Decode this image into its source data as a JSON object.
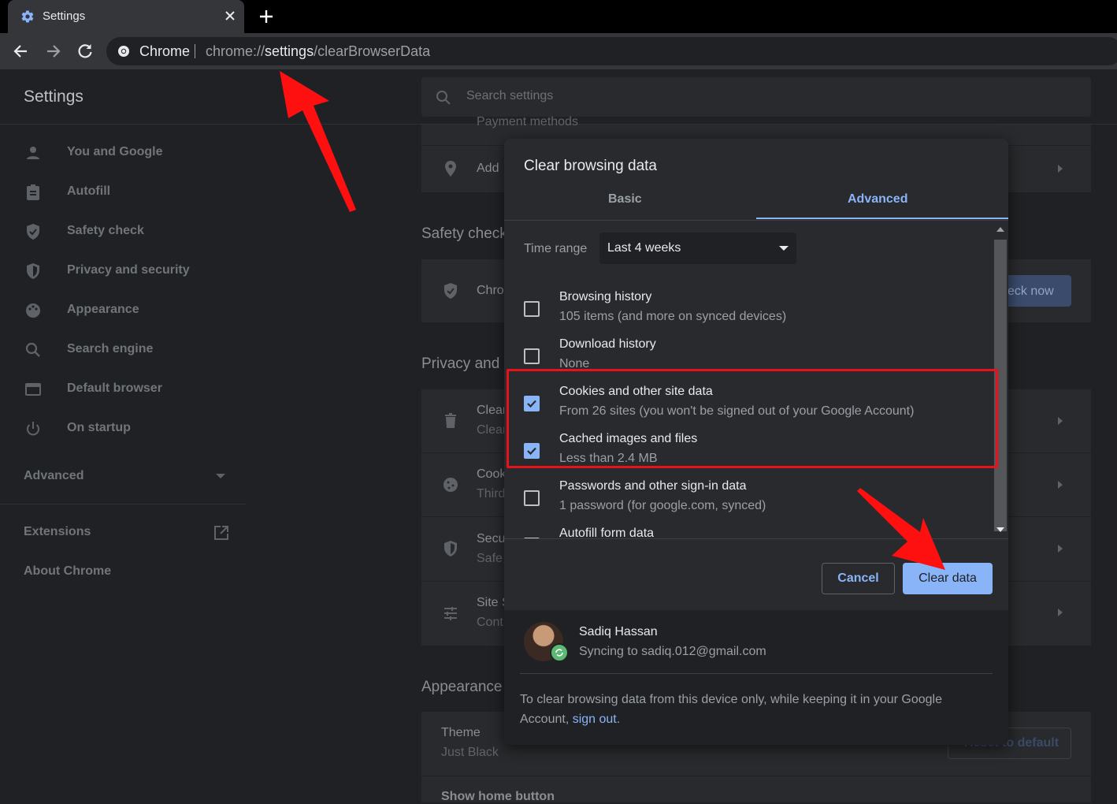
{
  "browser": {
    "tab_title": "Settings",
    "omnibox_label": "Chrome",
    "url_prefix": "chrome://",
    "url_highlight": "settings",
    "url_suffix": "/clearBrowserData"
  },
  "settings": {
    "title": "Settings",
    "search_placeholder": "Search settings"
  },
  "sidebar": {
    "items": [
      {
        "label": "You and Google",
        "icon": "person-icon"
      },
      {
        "label": "Autofill",
        "icon": "clipboard-icon"
      },
      {
        "label": "Safety check",
        "icon": "shield-check-icon"
      },
      {
        "label": "Privacy and security",
        "icon": "shield-icon"
      },
      {
        "label": "Appearance",
        "icon": "palette-icon"
      },
      {
        "label": "Search engine",
        "icon": "search-icon"
      },
      {
        "label": "Default browser",
        "icon": "browser-icon"
      },
      {
        "label": "On startup",
        "icon": "power-icon"
      }
    ],
    "advanced": "Advanced",
    "extensions": "Extensions",
    "about": "About Chrome"
  },
  "background": {
    "row_payment": "Payment methods",
    "row_add": "Add",
    "safety_title": "Safety check",
    "safety_row": "Chro",
    "check_now": "eck now",
    "privacy_title": "Privacy and s",
    "clear_t1": "Clear",
    "clear_t2": "Clear",
    "cookies_t1": "Cook",
    "cookies_t2": "Third",
    "security_t1": "Secu",
    "security_t2": "Safe",
    "site_t1": "Site S",
    "site_t2": "Cont",
    "appearance_title": "Appearance",
    "theme_t1": "Theme",
    "theme_t2": "Just Black",
    "reset_label": "Reset to default",
    "home_button": "Show home button"
  },
  "dialog": {
    "title": "Clear browsing data",
    "tabs": {
      "basic": "Basic",
      "advanced": "Advanced"
    },
    "time_range_label": "Time range",
    "time_range_value": "Last 4 weeks",
    "options": [
      {
        "title": "Browsing history",
        "desc": "105 items (and more on synced devices)",
        "checked": false
      },
      {
        "title": "Download history",
        "desc": "None",
        "checked": false
      },
      {
        "title": "Cookies and other site data",
        "desc": "From 26 sites (you won't be signed out of your Google Account)",
        "checked": true
      },
      {
        "title": "Cached images and files",
        "desc": "Less than 2.4 MB",
        "checked": true
      },
      {
        "title": "Passwords and other sign-in data",
        "desc": "1 password (for google.com, synced)",
        "checked": false
      },
      {
        "title": "Autofill form data",
        "desc": "",
        "checked": false
      }
    ],
    "cancel": "Cancel",
    "clear": "Clear data",
    "user_name": "Sadiq Hassan",
    "user_sync": "Syncing to sadiq.012@gmail.com",
    "footer_note": "To clear browsing data from this device only, while keeping it in your Google Account, ",
    "footer_link": "sign out",
    "footer_end": "."
  },
  "colors": {
    "accent": "#8ab4f8",
    "annotation": "#e8121b"
  }
}
